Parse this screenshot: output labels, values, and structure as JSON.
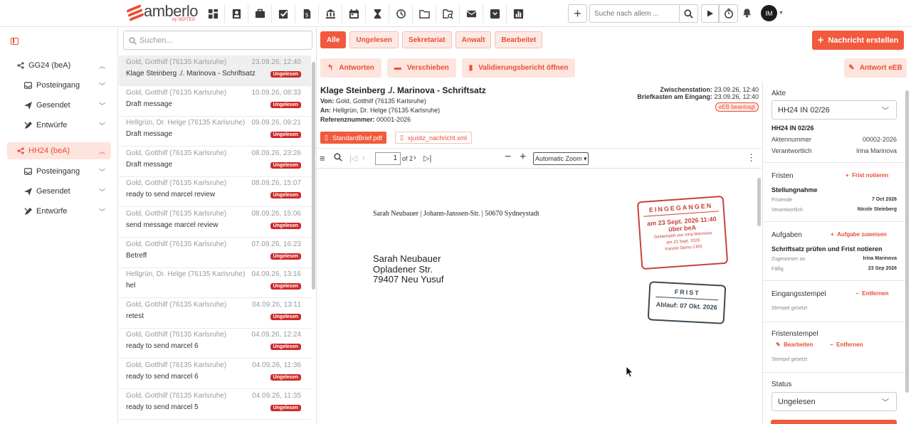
{
  "brand": {
    "name": "amberlo",
    "sub": "by SEPTEO"
  },
  "topbar": {
    "search_placeholder": "Suche nach allem ...",
    "avatar_initials": "IM",
    "nav_icons": [
      "dashboard-icon",
      "contacts-icon",
      "briefcase-icon",
      "tasks-icon",
      "invoice-icon",
      "bank-icon",
      "calendar-icon",
      "hourglass-icon",
      "history-icon",
      "folder-icon",
      "search-folder-icon",
      "mail-icon",
      "bea-inbox-icon",
      "reports-icon"
    ]
  },
  "sidebar": {
    "groups": [
      {
        "label": "GG24 (beA)",
        "active": false,
        "items": [
          "Posteingang",
          "Gesendet",
          "Entwürfe"
        ]
      },
      {
        "label": "HH24 (beA)",
        "active": true,
        "items": [
          "Posteingang",
          "Gesendet",
          "Entwürfe"
        ]
      }
    ]
  },
  "list": {
    "search_placeholder": "Suchen...",
    "messages": [
      {
        "from": "Gold, Gotthilf (76135 Karlsruhe)",
        "date": "23.09.26, 12:40",
        "subject": "Klage Steinberg ./. Marinova - Schriftsatz",
        "badge": "Ungelesen"
      },
      {
        "from": "Gold, Gotthilf (76135 Karlsruhe)",
        "date": "10.09.26, 08:33",
        "subject": "Draft message",
        "badge": "Ungelesen"
      },
      {
        "from": "Hellgrün, Dr. Helge (76135 Karlsruhe)",
        "date": "09.09.26, 09:21",
        "subject": "Draft message",
        "badge": "Ungelesen"
      },
      {
        "from": "Gold, Gotthilf (76135 Karlsruhe)",
        "date": "08.09.26, 23:26",
        "subject": "Draft message",
        "badge": "Ungelesen"
      },
      {
        "from": "Gold, Gotthilf (76135 Karlsruhe)",
        "date": "08.09.26, 15:07",
        "subject": "ready to send marcel review",
        "badge": "Ungelesen"
      },
      {
        "from": "Gold, Gotthilf (76135 Karlsruhe)",
        "date": "08.09.26, 15:06",
        "subject": "send message marcel review",
        "badge": "Ungelesen"
      },
      {
        "from": "Gold, Gotthilf (76135 Karlsruhe)",
        "date": "07.09.26, 16:23",
        "subject": "Betreff",
        "badge": "Ungelesen"
      },
      {
        "from": "Hellgrün, Dr. Helge (76135 Karlsruhe)",
        "date": "04.09.26, 13:16",
        "subject": "hel",
        "badge": "Ungelesen"
      },
      {
        "from": "Gold, Gotthilf (76135 Karlsruhe)",
        "date": "04.09.26, 13:11",
        "subject": "retest",
        "badge": "Ungelesen"
      },
      {
        "from": "Gold, Gotthilf (76135 Karlsruhe)",
        "date": "04.09.26, 12:24",
        "subject": "ready to send marcel 6",
        "badge": "Ungelesen"
      },
      {
        "from": "Gold, Gotthilf (76135 Karlsruhe)",
        "date": "04.09.26, 11:36",
        "subject": "ready to send marcel 6",
        "badge": "Ungelesen"
      },
      {
        "from": "Gold, Gotthilf (76135 Karlsruhe)",
        "date": "04.09.26, 11:35",
        "subject": "ready to send marcel 5",
        "badge": "Ungelesen"
      }
    ]
  },
  "filters": [
    "Alle",
    "Ungelesen",
    "Sekretariat",
    "Anwalt",
    "Bearbeitet"
  ],
  "new_message": "Nachricht erstellen",
  "actions": {
    "reply": "Antworten",
    "move": "Verschieben",
    "validation": "Validierungsbericht öffnen",
    "eeb": "Antwort eEB"
  },
  "message": {
    "title": "Klage Steinberg ./. Marinova - Schriftsatz",
    "from_label": "Von:",
    "from": "Gold, Gotthilf (76135 Karlsruhe)",
    "to_label": "An:",
    "to": "Hellgrün, Dr. Helge (76135 Karlsruhe)",
    "ref_label": "Referenznummer:",
    "ref": "00001-2026",
    "relay_label": "Zwischenstation:",
    "relay": "23.09.26, 12:40",
    "mailbox_label": "Briefkasten am Eingang:",
    "mailbox": "23.09.26, 12:40",
    "eeb_badge": "eEB beantragt",
    "attachments": [
      "StandardBrief.pdf",
      "xjustiz_nachricht.xml"
    ]
  },
  "pdf": {
    "page": "1",
    "of": "of 2",
    "zoom": "Automatic Zoom",
    "sender_line": "Sarah Neubauer | Johann-Janssen-Str. | 50670 Sydneystadt",
    "address": [
      "Sarah Neubauer",
      "Opladener Str.",
      "79407 Neu Yusuf"
    ],
    "stamp_received": {
      "title": "EINGEGANGEN",
      "line1": "am 23 Sept. 2026 11:40",
      "line2": "über beA",
      "small1": "Gestempelt von Irina Marinova",
      "small2": "am 23 Sept. 2026",
      "small3": "Kanzlei Demo CMS"
    },
    "stamp_deadline": {
      "title": "FRIST",
      "line1": "Ablauf: 07 Okt. 2026"
    }
  },
  "details": {
    "akte_label": "Akte",
    "akte_value": "HH24 IN 02/26",
    "akte_title": "HH24 IN 02/26",
    "file_number_label": "Aktennummer",
    "file_number": "00002-2026",
    "responsible_label": "Verantwortlich",
    "responsible": "Irina Marinova",
    "deadlines_label": "Fristen",
    "deadlines_action": "Frist notieren",
    "deadline_title": "Stellungnahme",
    "deadline_end_label": "Fristende",
    "deadline_end": "7 Oct 2026",
    "deadline_resp_label": "Verantwortlich",
    "deadline_resp": "Nicole Steinberg",
    "tasks_label": "Aufgaben",
    "tasks_action": "Aufgabe zuweisen",
    "task_title": "Schriftsatz prüfen und Frist notieren",
    "task_assigned_label": "Zugewiesen an",
    "task_assigned": "Irina Marinova",
    "task_due_label": "Fällig",
    "task_due": "23 Sep 2026",
    "received_stamp_label": "Eingangsstempel",
    "received_stamp_action": "Entfernen",
    "received_stamp_status": "Stempel gesetzt",
    "deadline_stamp_label": "Fristenstempel",
    "deadline_stamp_edit": "Bearbeiten",
    "deadline_stamp_remove": "Entfernen",
    "deadline_stamp_status": "Stempel gesetzt",
    "status_label": "Status",
    "status_value": "Ungelesen"
  }
}
